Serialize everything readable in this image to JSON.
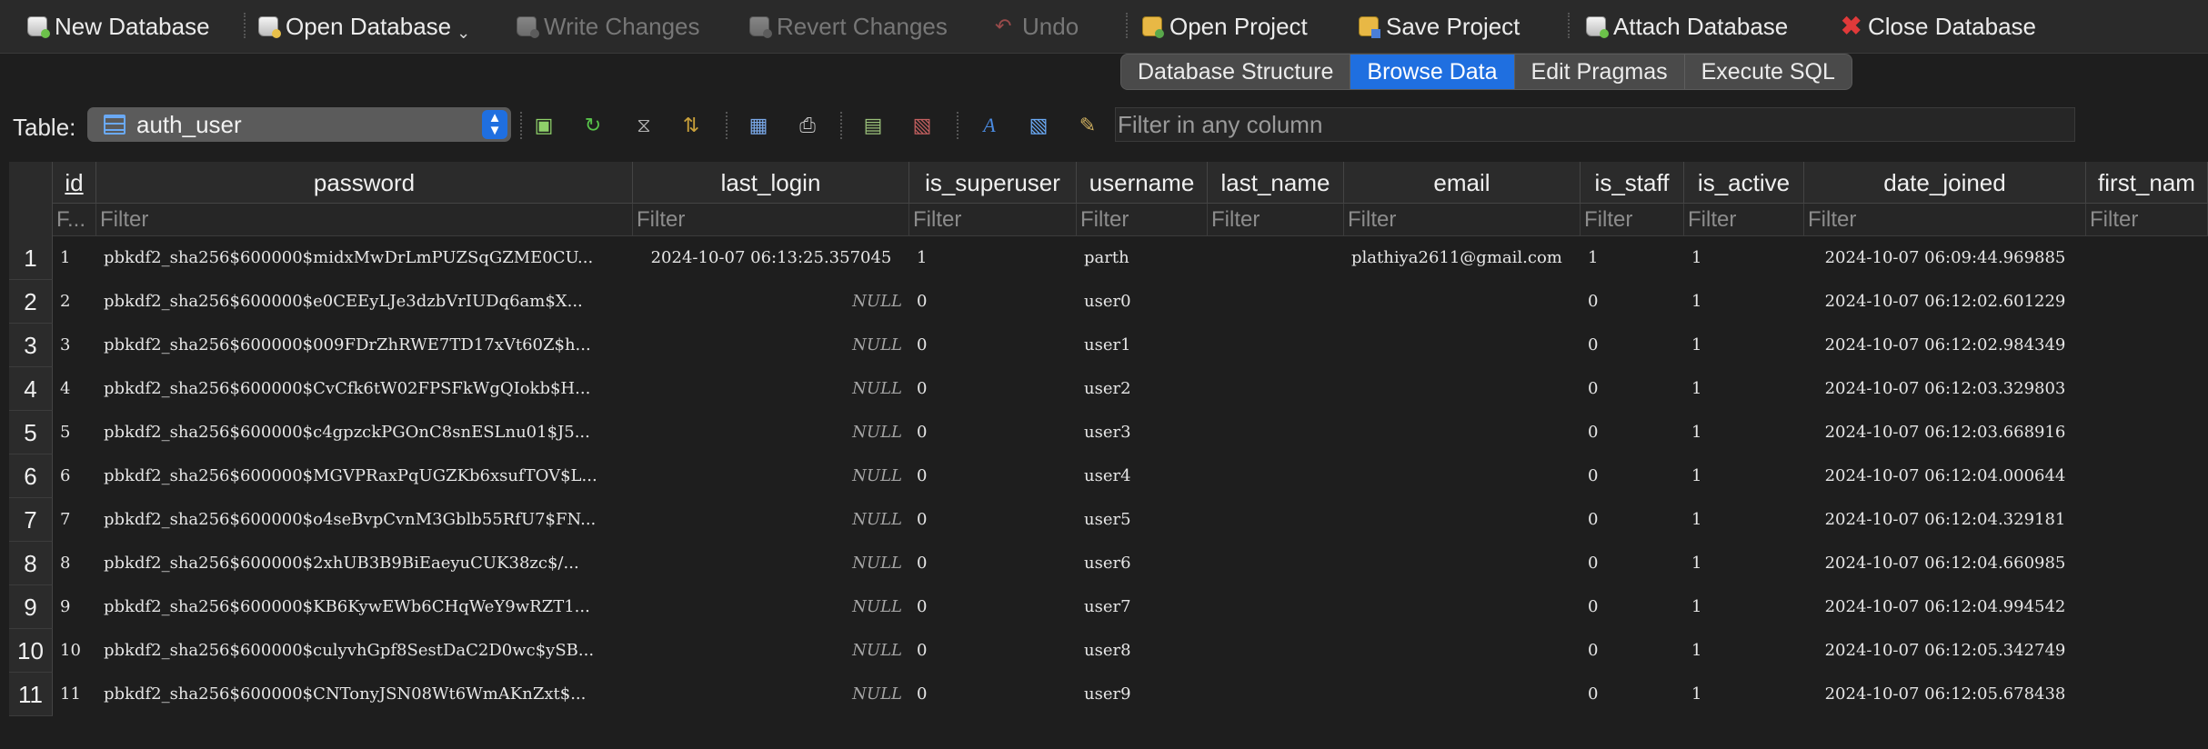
{
  "toolbar": {
    "new_database": "New Database",
    "open_database": "Open Database",
    "write_changes": "Write Changes",
    "revert_changes": "Revert Changes",
    "undo": "Undo",
    "open_project": "Open Project",
    "save_project": "Save Project",
    "attach_database": "Attach Database",
    "close_database": "Close Database"
  },
  "mode_tabs": [
    "Database Structure",
    "Browse Data",
    "Edit Pragmas",
    "Execute SQL"
  ],
  "active_tab": "Browse Data",
  "table_selector": {
    "label": "Table:",
    "selected": "auth_user"
  },
  "filter_any": {
    "placeholder": "Filter in any column"
  },
  "grid": {
    "columns": [
      "id",
      "password",
      "last_login",
      "is_superuser",
      "username",
      "last_name",
      "email",
      "is_staff",
      "is_active",
      "date_joined",
      "first_nam"
    ],
    "filter_placeholders": [
      "F...",
      "Filter",
      "Filter",
      "Filter",
      "Filter",
      "Filter",
      "Filter",
      "Filter",
      "Filter",
      "Filter",
      "Filter"
    ],
    "row_numbers": [
      "1",
      "2",
      "3",
      "4",
      "5",
      "6",
      "7",
      "8",
      "9",
      "10",
      "11"
    ],
    "rows": [
      [
        "1",
        "pbkdf2_sha256$600000$midxMwDrLmPUZSqGZME0CU...",
        "2024-10-07 06:13:25.357045",
        "1",
        "parth",
        "",
        "plathiya2611@gmail.com",
        "1",
        "1",
        "2024-10-07 06:09:44.969885"
      ],
      [
        "2",
        "pbkdf2_sha256$600000$e0CEEyLJe3dzbVrIUDq6am$X...",
        "NULL",
        "0",
        "user0",
        "",
        "",
        "0",
        "1",
        "2024-10-07 06:12:02.601229"
      ],
      [
        "3",
        "pbkdf2_sha256$600000$009FDrZhRWE7TD17xVt60Z$h...",
        "NULL",
        "0",
        "user1",
        "",
        "",
        "0",
        "1",
        "2024-10-07 06:12:02.984349"
      ],
      [
        "4",
        "pbkdf2_sha256$600000$CvCfk6tW02FPSFkWgQIokb$H...",
        "NULL",
        "0",
        "user2",
        "",
        "",
        "0",
        "1",
        "2024-10-07 06:12:03.329803"
      ],
      [
        "5",
        "pbkdf2_sha256$600000$c4gpzckPGOnC8snESLnu01$J5...",
        "NULL",
        "0",
        "user3",
        "",
        "",
        "0",
        "1",
        "2024-10-07 06:12:03.668916"
      ],
      [
        "6",
        "pbkdf2_sha256$600000$MGVPRaxPqUGZKb6xsufTOV$L...",
        "NULL",
        "0",
        "user4",
        "",
        "",
        "0",
        "1",
        "2024-10-07 06:12:04.000644"
      ],
      [
        "7",
        "pbkdf2_sha256$600000$o4seBvpCvnM3Gblb55RfU7$FN...",
        "NULL",
        "0",
        "user5",
        "",
        "",
        "0",
        "1",
        "2024-10-07 06:12:04.329181"
      ],
      [
        "8",
        "pbkdf2_sha256$600000$2xhUB3B9BiEaeyuCUK38zc$/...",
        "NULL",
        "0",
        "user6",
        "",
        "",
        "0",
        "1",
        "2024-10-07 06:12:04.660985"
      ],
      [
        "9",
        "pbkdf2_sha256$600000$KB6KywEWb6CHqWeY9wRZT1...",
        "NULL",
        "0",
        "user7",
        "",
        "",
        "0",
        "1",
        "2024-10-07 06:12:04.994542"
      ],
      [
        "10",
        "pbkdf2_sha256$600000$culyvhGpf8SestDaC2D0wc$ySB...",
        "NULL",
        "0",
        "user8",
        "",
        "",
        "0",
        "1",
        "2024-10-07 06:12:05.342749"
      ],
      [
        "11",
        "pbkdf2_sha256$600000$CNTonyJSN08Wt6WmAKnZxt$...",
        "NULL",
        "0",
        "user9",
        "",
        "",
        "0",
        "1",
        "2024-10-07 06:12:05.678438"
      ]
    ]
  },
  "colors": {
    "accent": "#1f6fe0",
    "background": "#1e1e1e",
    "close_icon": "#e03a3a"
  }
}
